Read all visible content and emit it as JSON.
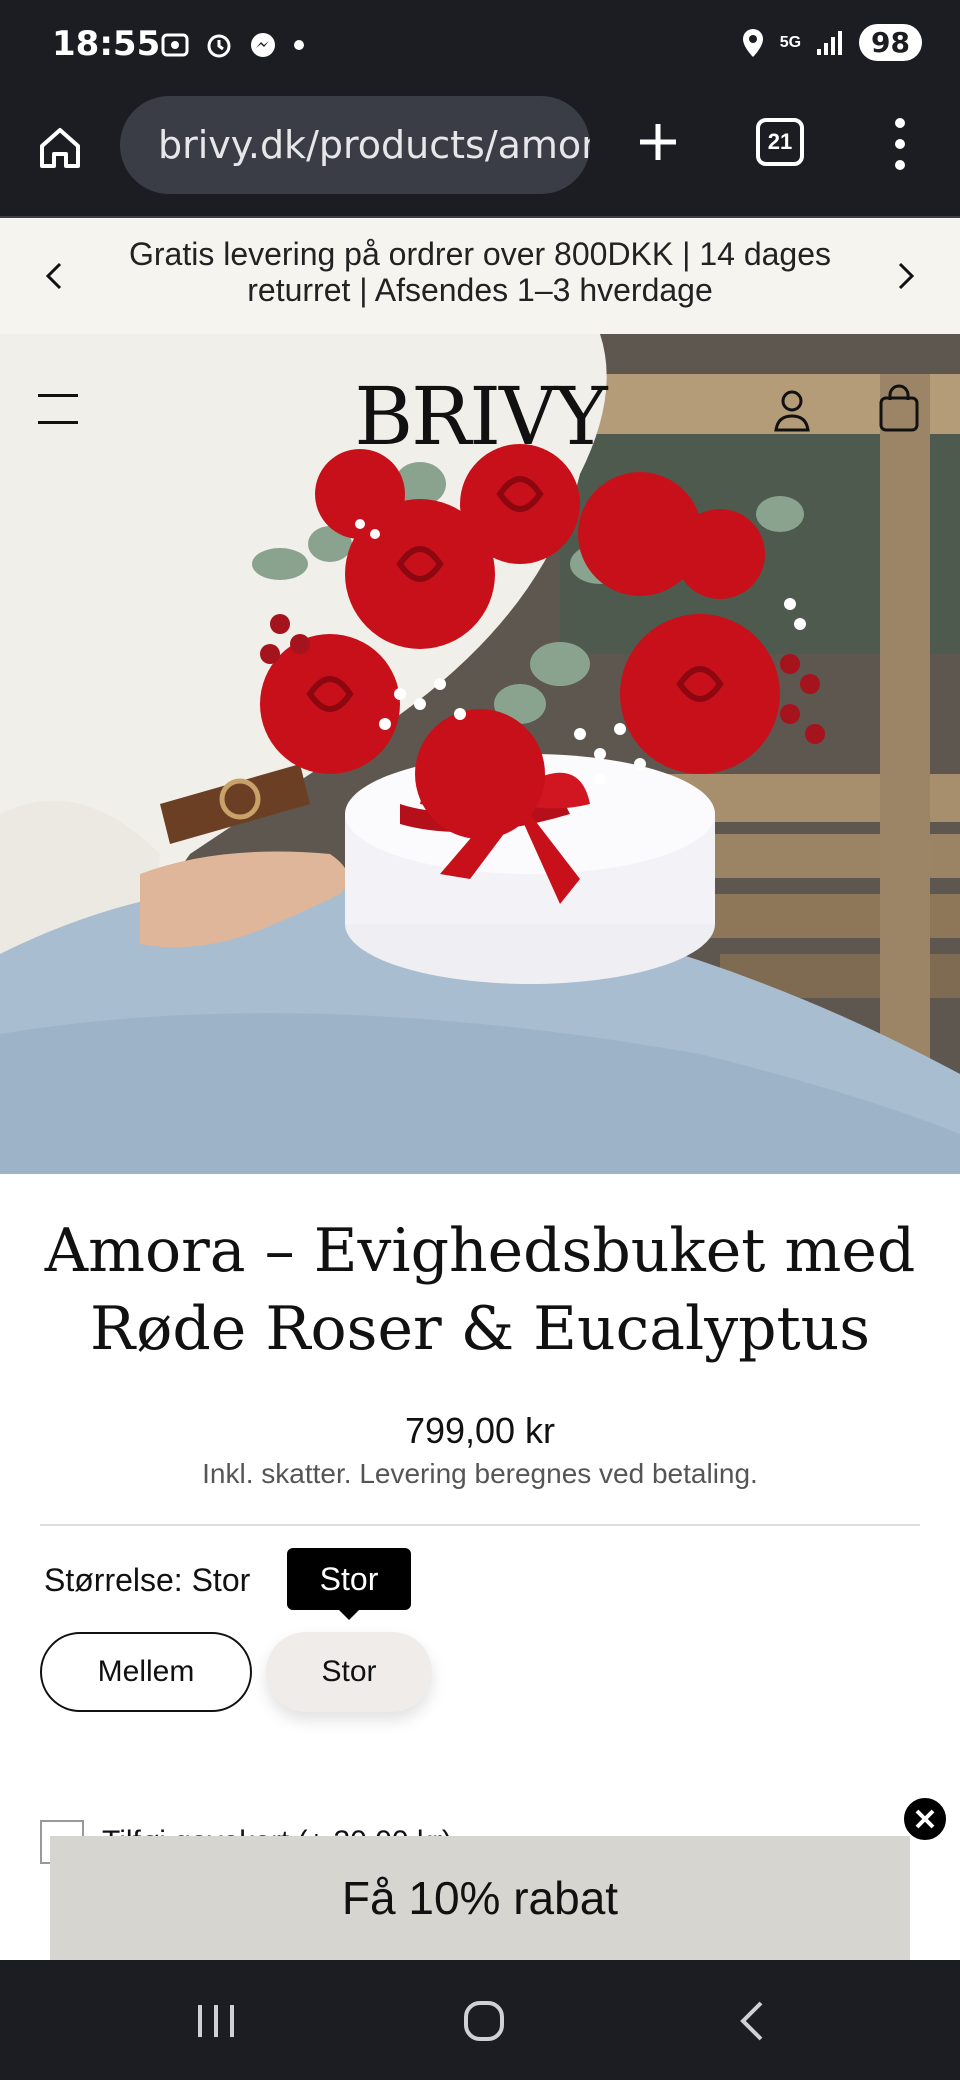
{
  "status_bar": {
    "time": "18:55",
    "network": "5G",
    "battery": "98"
  },
  "browser": {
    "url": "brivy.dk/products/amora",
    "tab_count": "21"
  },
  "announcement": {
    "text": "Gratis levering på ordrer over 800DKK | 14 dages returret | Afsendes 1–3 hverdage"
  },
  "site": {
    "logo": "BRIVY"
  },
  "product": {
    "title": "Amora – Evighedsbuket med Røde Roser & Eucalyptus",
    "price": "799,00 kr",
    "tax_note": "Inkl. skatter. Levering beregnes ved betaling.",
    "size_label": "Størrelse: Stor",
    "size_tooltip": "Stor",
    "variants": [
      {
        "label": "Mellem",
        "selected": false
      },
      {
        "label": "Stor",
        "selected": true
      }
    ],
    "addon_text": "Tilføj gavekort (+ 30,00 kr)"
  },
  "popup": {
    "discount_label": "Få 10% rabat"
  },
  "colors": {
    "system_bar": "#1b1d22",
    "announcement_bg": "#f6f4ef",
    "popup_bg": "#d7d5d0",
    "rose_red": "#c8101a"
  }
}
